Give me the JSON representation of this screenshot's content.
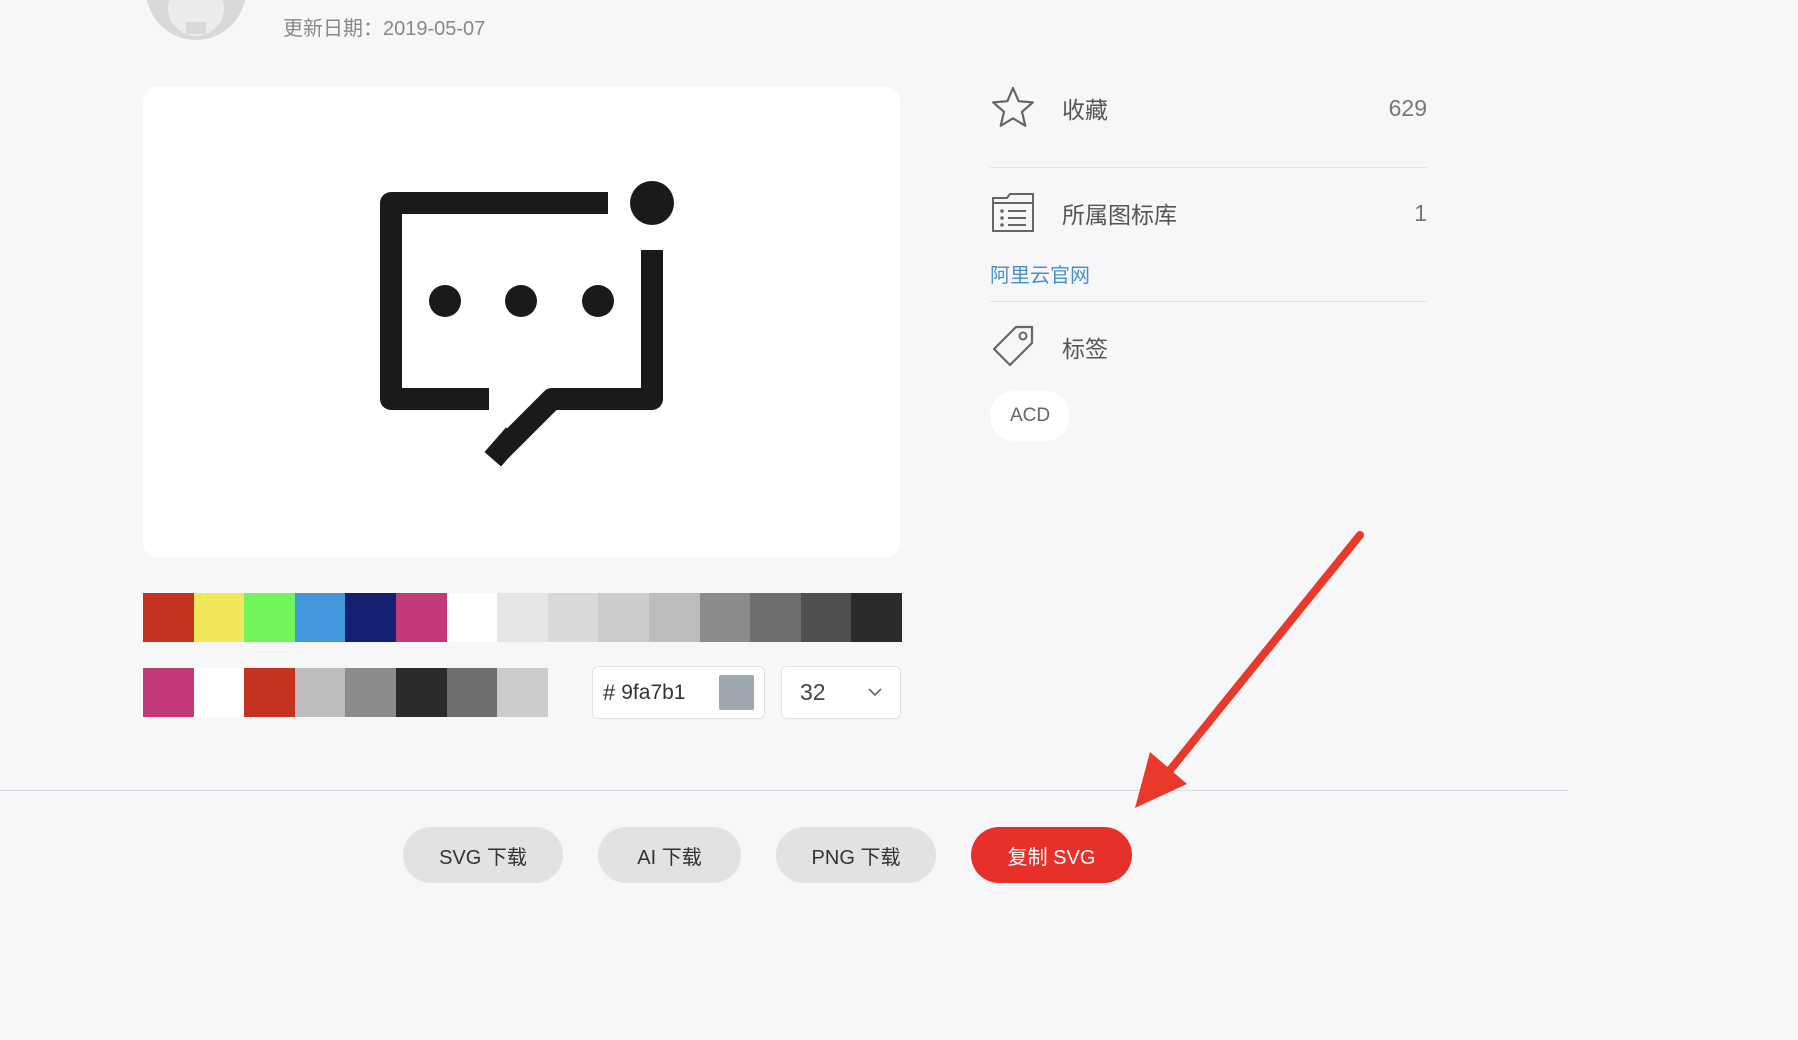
{
  "header": {
    "update_date": "更新日期：2019-05-07"
  },
  "preview": {
    "icon": "chat-bubble-dots-icon"
  },
  "palette": {
    "main": [
      "#c5321f",
      "#f2e65a",
      "#72f55a",
      "#4496da",
      "#152170",
      "#c33a7a",
      "#ffffff",
      "#e6e6e6",
      "#d9d9d9",
      "#cccccc",
      "#bdbdbd",
      "#8c8c8c",
      "#6e6e6e",
      "#505050",
      "#2b2b2b"
    ],
    "recent": [
      "#c33a7a",
      "#ffffff",
      "#c5321f",
      "#bdbdbd",
      "#8c8c8c",
      "#2b2b2b",
      "#6e6e6e",
      "#cccccc"
    ]
  },
  "color_input": {
    "hash": "#",
    "value": "9fa7b1",
    "chip_color": "#9fa7b1"
  },
  "size_select": {
    "value": "32"
  },
  "sidebar": {
    "favorite": {
      "label": "收藏",
      "count": "629",
      "icon": "star-icon"
    },
    "library": {
      "label": "所属图标库",
      "count": "1",
      "icon": "library-list-icon",
      "link": "阿里云官网"
    },
    "tags": {
      "label": "标签",
      "icon": "tag-icon",
      "items": [
        "ACD"
      ]
    }
  },
  "actions": {
    "svg_download": "SVG 下载",
    "ai_download": "AI 下载",
    "png_download": "PNG 下载",
    "copy_svg": "复制 SVG"
  },
  "colors": {
    "accent": "#e8302a",
    "link": "#4a8fcc",
    "arrow": "#e8392b"
  }
}
